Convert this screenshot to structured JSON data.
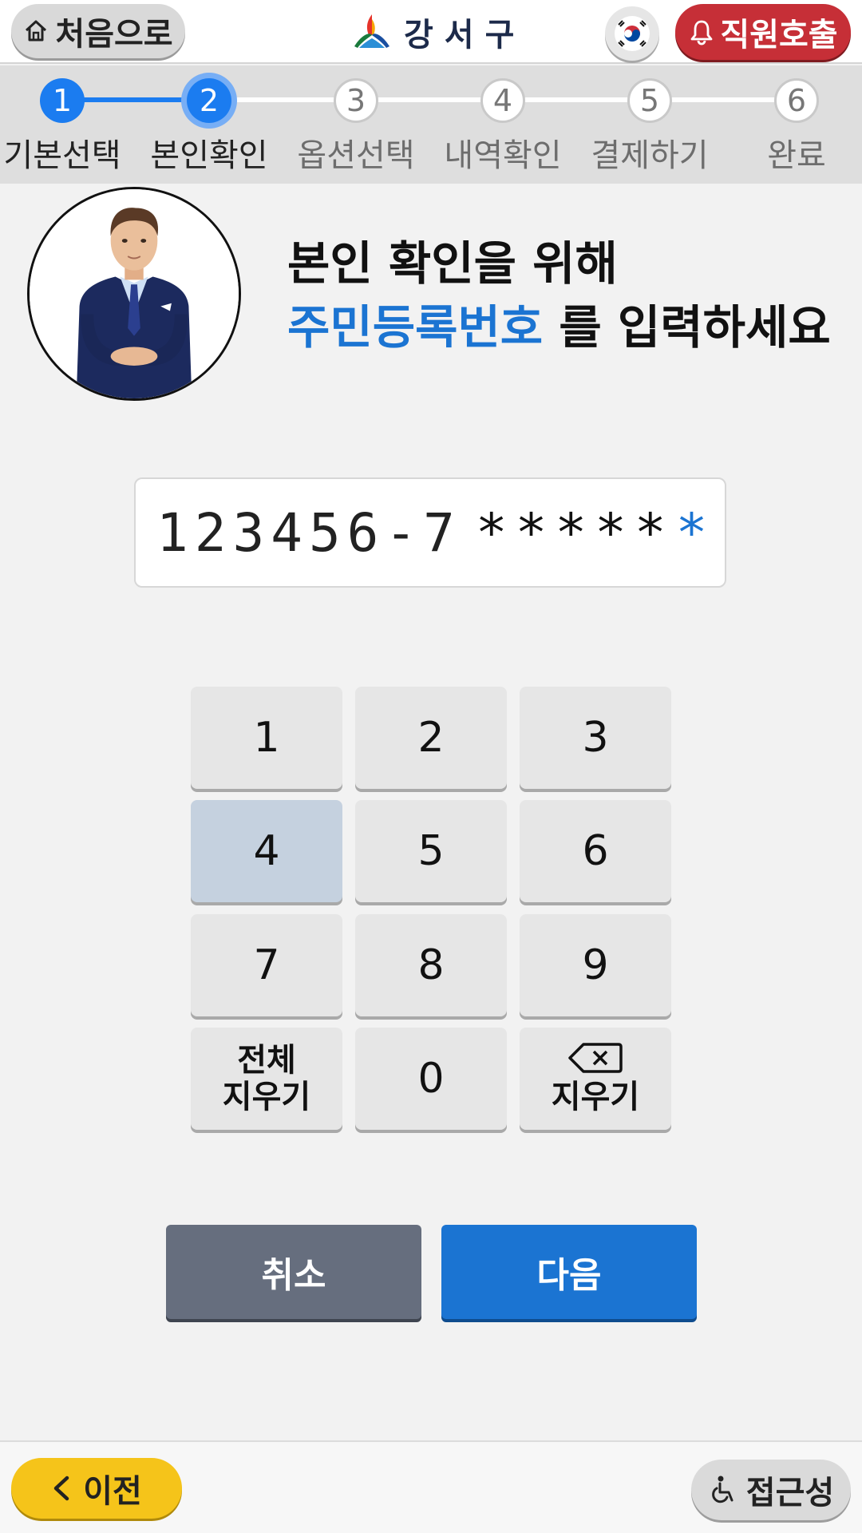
{
  "header": {
    "home_label": "처음으로",
    "logo_text": "강서구",
    "staff_call_label": "직원호출"
  },
  "stepper": {
    "steps": [
      {
        "num": "1",
        "label": "기본선택",
        "state": "done"
      },
      {
        "num": "2",
        "label": "본인확인",
        "state": "current"
      },
      {
        "num": "3",
        "label": "옵션선택",
        "state": "todo"
      },
      {
        "num": "4",
        "label": "내역확인",
        "state": "todo"
      },
      {
        "num": "5",
        "label": "결제하기",
        "state": "todo"
      },
      {
        "num": "6",
        "label": "완료",
        "state": "todo"
      }
    ]
  },
  "instruction": {
    "line1": "본인 확인을 위해",
    "highlight": "주민등록번호",
    "line2_rest": " 를 입력하세요"
  },
  "id_input": {
    "entered": "123456-7",
    "mask": "*****",
    "cursor": "*"
  },
  "keypad": {
    "keys": [
      "1",
      "2",
      "3",
      "4",
      "5",
      "6",
      "7",
      "8",
      "9"
    ],
    "clear_all_line1": "전체",
    "clear_all_line2": "지우기",
    "zero": "0",
    "backspace_label": "지우기",
    "pressed_key": "4"
  },
  "actions": {
    "cancel_label": "취소",
    "next_label": "다음"
  },
  "footer": {
    "prev_label": "이전",
    "accessibility_label": "접근성"
  },
  "colors": {
    "accent_blue": "#1b74d2",
    "step_blue": "#1b7cf0",
    "staff_red": "#c62f37",
    "prev_yellow": "#f5c41a",
    "cancel_gray": "#666e7e"
  }
}
